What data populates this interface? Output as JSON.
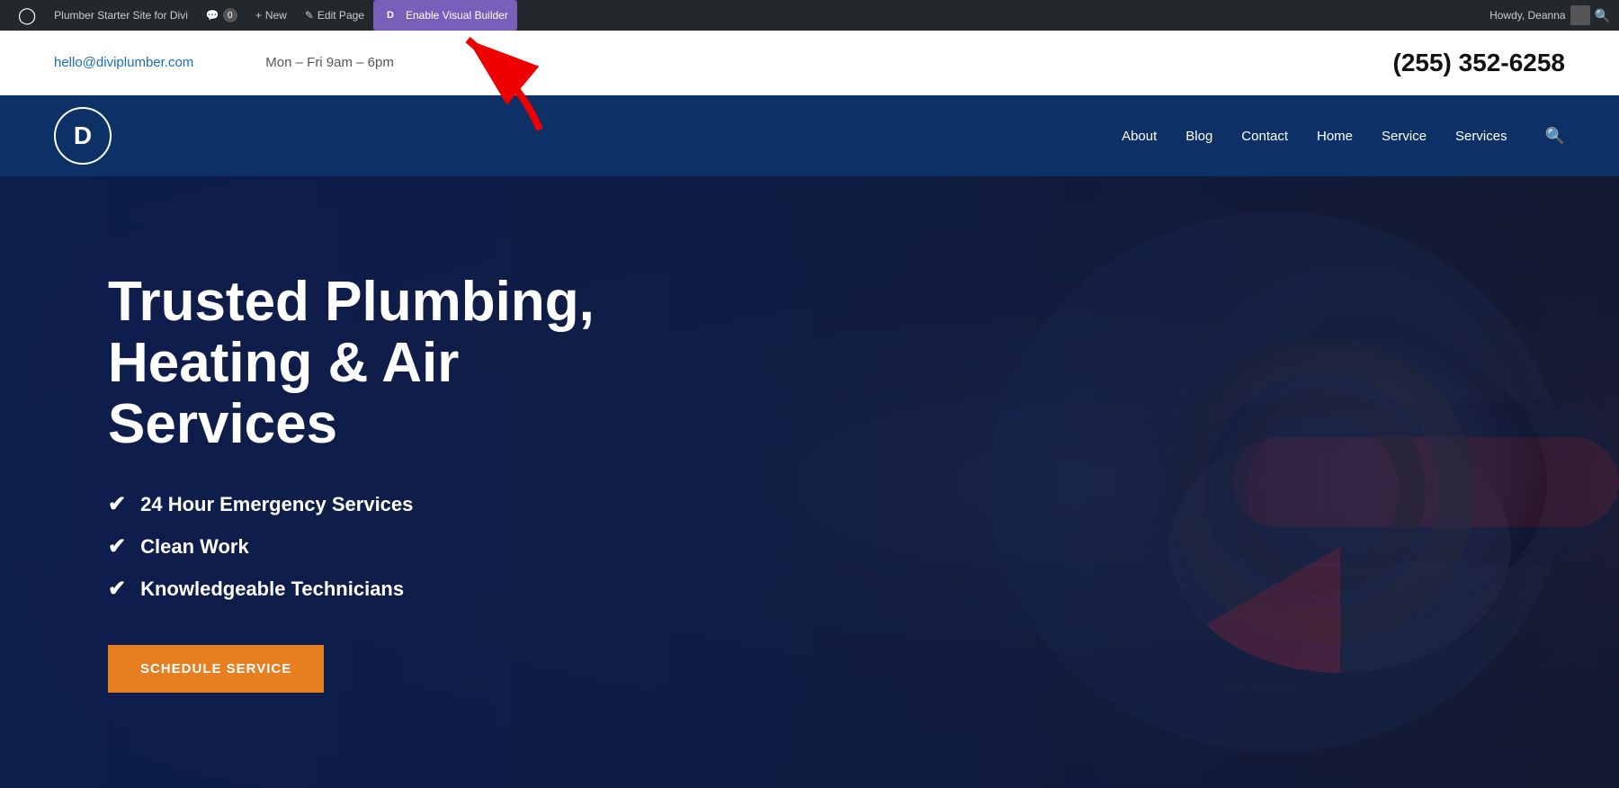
{
  "admin_bar": {
    "site_title": "Plumber Starter Site for Divi",
    "comment_label": "Comments",
    "comment_count": "0",
    "new_label": "New",
    "edit_page_label": "Edit Page",
    "visual_builder_label": "Enable Visual Builder",
    "howdy_text": "Howdy, Deanna",
    "wp_icon": "⊕",
    "divi_icon": "D",
    "colors": {
      "admin_bg": "#23282d",
      "divi_purple": "#7a5fba"
    }
  },
  "info_bar": {
    "email": "hello@diviplumber.com",
    "hours": "Mon – Fri 9am – 6pm",
    "phone": "(255) 352-6258"
  },
  "nav": {
    "logo_letter": "D",
    "links": [
      {
        "label": "About"
      },
      {
        "label": "Blog"
      },
      {
        "label": "Contact"
      },
      {
        "label": "Home"
      },
      {
        "label": "Service"
      },
      {
        "label": "Services"
      }
    ],
    "search_icon": "🔍"
  },
  "hero": {
    "title_line1": "Trusted Plumbing,",
    "title_line2": "Heating & Air Services",
    "features": [
      "24 Hour Emergency Services",
      "Clean Work",
      "Knowledgeable Technicians"
    ],
    "cta_label": "SCHEDULE SERVICE"
  }
}
